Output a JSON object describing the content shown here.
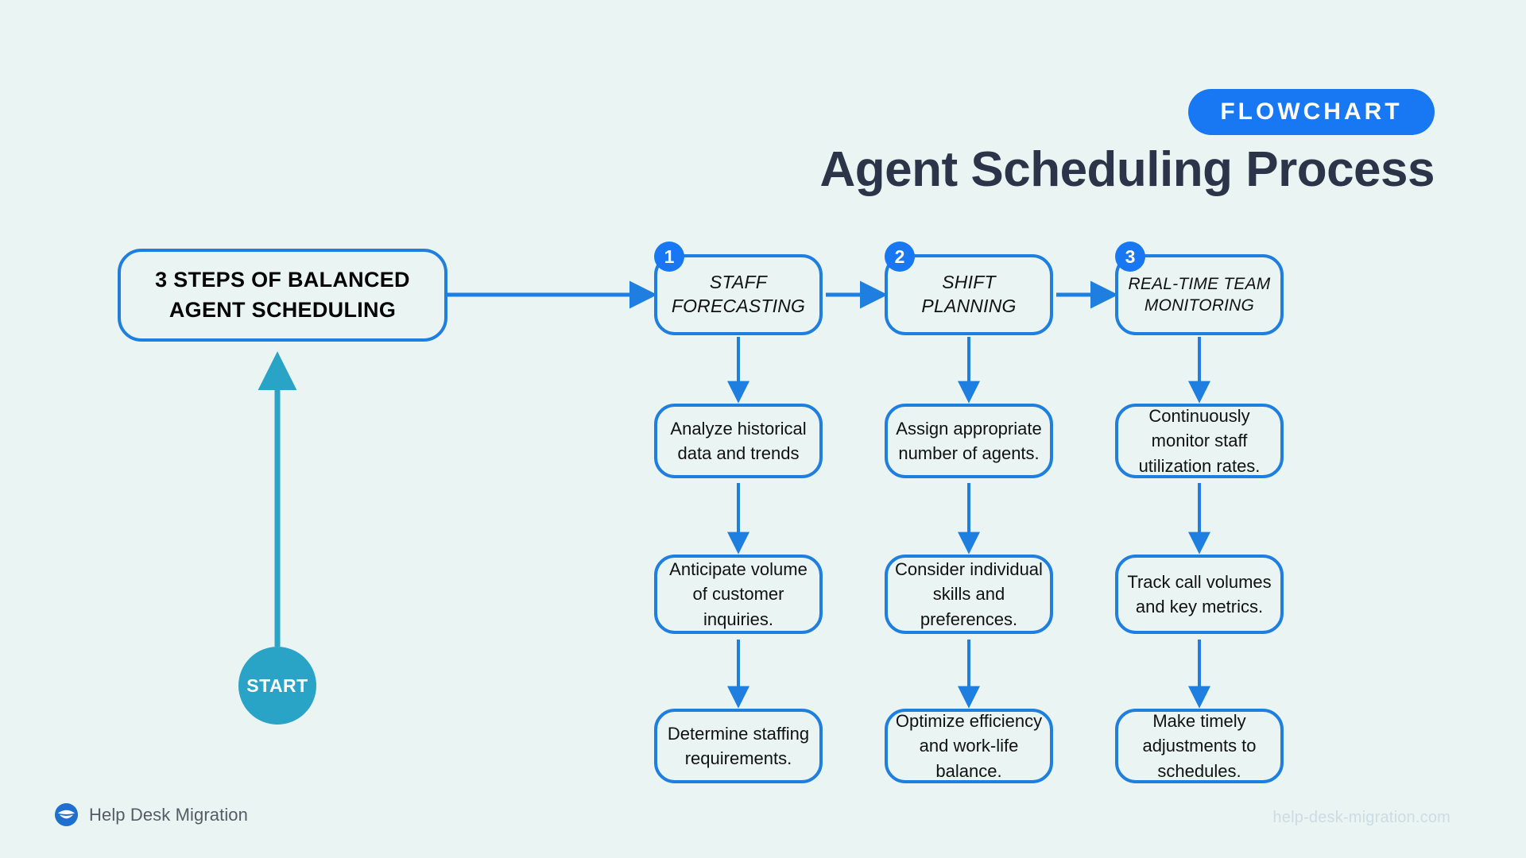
{
  "header": {
    "badge": "FLOWCHART",
    "title": "Agent Scheduling Process"
  },
  "colors": {
    "background": "#eaf4f3",
    "accent_blue": "#1877f2",
    "line_blue": "#1f7fe0",
    "start_teal": "#29a3c6",
    "title_navy": "#2b3448",
    "footer_url": "#ccdbe4"
  },
  "intro": {
    "line1": "3 STEPS OF BALANCED",
    "line2": "AGENT SCHEDULING"
  },
  "start": {
    "label": "START"
  },
  "columns": [
    {
      "number": "1",
      "step_line1": "STAFF",
      "step_line2": "FORECASTING",
      "details": [
        "Analyze historical data and trends",
        "Anticipate volume of customer inquiries.",
        "Determine staffing requirements."
      ]
    },
    {
      "number": "2",
      "step_line1": "SHIFT",
      "step_line2": "PLANNING",
      "details": [
        "Assign appropriate number of agents.",
        "Consider individual skills and preferences.",
        "Optimize efficiency and work-life balance."
      ]
    },
    {
      "number": "3",
      "step_line1": "REAL-TIME TEAM",
      "step_line2": "MONITORING",
      "details": [
        "Continuously monitor staff utilization rates.",
        "Track call volumes and key metrics.",
        "Make timely adjustments to schedules."
      ]
    }
  ],
  "footer": {
    "brand_name": "Help Desk Migration",
    "url": "help-desk-migration.com"
  }
}
